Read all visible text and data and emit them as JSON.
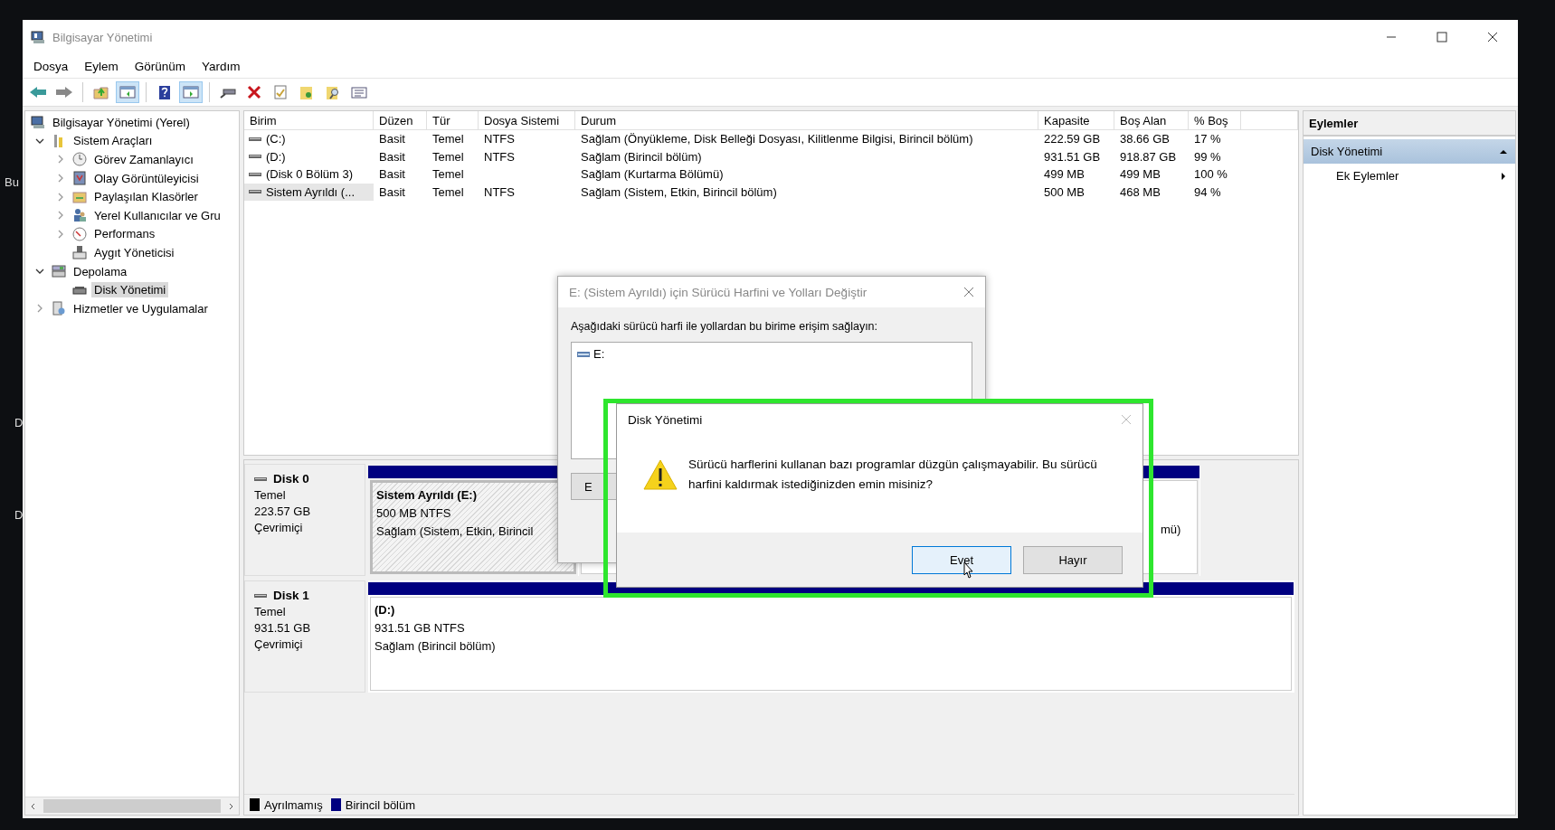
{
  "desktop": {
    "labels": [
      "Bu",
      "D",
      "D"
    ]
  },
  "window": {
    "title": "Bilgisayar Yönetimi"
  },
  "menu": [
    "Dosya",
    "Eylem",
    "Görünüm",
    "Yardım"
  ],
  "toolbar": [
    {
      "buttons": [
        {
          "pressed": false
        },
        {
          "pressed": false
        }
      ]
    },
    {
      "buttons": [
        {
          "pressed": false
        },
        {
          "pressed": true
        }
      ]
    },
    {
      "buttons": [
        {
          "pressed": false
        },
        {
          "pressed": true
        }
      ]
    },
    {
      "buttons": [
        {
          "pressed": false
        },
        {
          "pressed": false
        },
        {
          "pressed": false
        },
        {
          "pressed": false
        },
        {
          "pressed": false
        },
        {
          "pressed": false
        }
      ]
    }
  ],
  "tree": [
    {
      "label": "Bilgisayar Yönetimi (Yerel)",
      "selected": false,
      "children": [
        {
          "label": "Sistem Araçları",
          "selected": false,
          "expanded": true,
          "children": [
            {
              "label": "Görev Zamanlayıcı",
              "selected": false,
              "expanded": false
            },
            {
              "label": "Olay Görüntüleyicisi",
              "selected": false,
              "expanded": false
            },
            {
              "label": "Paylaşılan Klasörler",
              "selected": false,
              "expanded": false
            },
            {
              "label": "Yerel Kullanıcılar ve Gru",
              "selected": false,
              "expanded": false
            },
            {
              "label": "Performans",
              "selected": false,
              "expanded": false
            },
            {
              "label": "Aygıt Yöneticisi",
              "selected": false
            }
          ]
        },
        {
          "label": "Depolama",
          "selected": false,
          "expanded": true,
          "children": [
            {
              "label": "Disk Yönetimi",
              "selected": true
            }
          ]
        },
        {
          "label": "Hizmetler ve Uygulamalar",
          "selected": false,
          "expanded": false
        }
      ]
    }
  ],
  "table": {
    "columns": [
      "Birim",
      "Düzen",
      "Tür",
      "Dosya Sistemi",
      "Durum",
      "Kapasite",
      "Boş Alan",
      "% Boş"
    ],
    "rows": [
      {
        "focused": false,
        "cells": [
          "(C:)",
          "Basit",
          "Temel",
          "NTFS",
          "Sağlam (Önyükleme, Disk Belleği Dosyası, Kilitlenme Bilgisi, Birincil bölüm)",
          "222.59 GB",
          "38.66 GB",
          "17 %"
        ]
      },
      {
        "focused": false,
        "cells": [
          "(D:)",
          "Basit",
          "Temel",
          "NTFS",
          "Sağlam (Birincil bölüm)",
          "931.51 GB",
          "918.87 GB",
          "99 %"
        ]
      },
      {
        "focused": false,
        "cells": [
          "(Disk 0 Bölüm 3)",
          "Basit",
          "Temel",
          "",
          "Sağlam (Kurtarma Bölümü)",
          "499 MB",
          "499 MB",
          "100 %"
        ]
      },
      {
        "focused": true,
        "cells": [
          "Sistem Ayrıldı (...",
          "Basit",
          "Temel",
          "NTFS",
          "Sağlam (Sistem, Etkin, Birincil bölüm)",
          "500 MB",
          "468 MB",
          "94 %"
        ]
      }
    ]
  },
  "disks": [
    {
      "name": "Disk 0",
      "type": "Temel",
      "size": "223.57 GB",
      "state": "Çevrimiçi",
      "partitions": [
        {
          "name": "Sistem Ayrıldı  (E:)",
          "size": "500 MB NTFS",
          "status": "Sağlam (Sistem, Etkin, Birincil",
          "selected": true
        },
        {
          "selected": false
        },
        {
          "status": "mü)",
          "selected": false
        }
      ]
    },
    {
      "name": "Disk 1",
      "type": "Temel",
      "size": "931.51 GB",
      "state": "Çevrimiçi",
      "partitions": [
        {
          "name": "(D:)",
          "size": "931.51 GB NTFS",
          "status": "Sağlam (Birincil bölüm)",
          "selected": false
        }
      ]
    }
  ],
  "legend": [
    {
      "label": "Ayrılmamış",
      "color": "#000000"
    },
    {
      "label": "Birincil bölüm",
      "color": "#000080"
    }
  ],
  "actions": {
    "header": "Eylemler",
    "items": [
      {
        "label": "Disk Yönetimi",
        "kind": "section",
        "selected": true
      },
      {
        "label": "Ek Eylemler",
        "kind": "submenu",
        "selected": false
      }
    ]
  },
  "letter_dialog": {
    "title": "E: (Sistem Ayrıldı) için Sürücü Harfini ve Yolları Değiştir",
    "prompt": "Aşağıdaki sürücü harfi ile yollardan bu birime erişim sağlayın:",
    "list": [
      "E:"
    ],
    "button": "E"
  },
  "confirm_dialog": {
    "title": "Disk Yönetimi",
    "message": "Sürücü harflerini kullanan bazı programlar düzgün çalışmayabilir. Bu sürücü harfini kaldırmak istediğinizden emin misiniz?",
    "buttons": [
      {
        "label": "Evet",
        "default": true
      },
      {
        "label": "Hayır",
        "default": false
      }
    ]
  }
}
